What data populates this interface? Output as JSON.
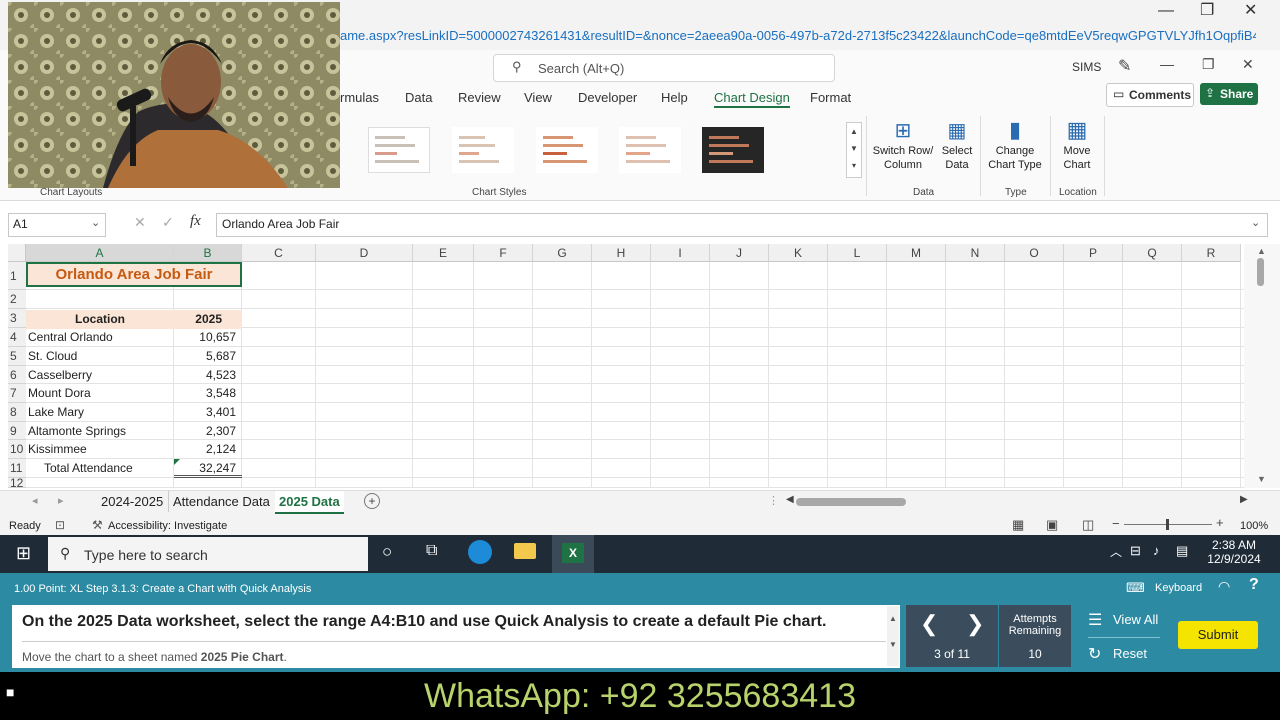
{
  "titlebar": {
    "url": "ame.aspx?resLinkID=5000002743261431&resultID=&nonce=2aeea90a-0056-497b-a72d-2713f5c23422&launchCode=qe8mtdEeV5reqwGPGTVLYJfh1OqpfiB4...",
    "minimize": "—",
    "restore": "❐",
    "close": "✕"
  },
  "ribbon": {
    "search_placeholder": "Search (Alt+Q)",
    "user": "SIMS",
    "tabs": [
      "rmulas",
      "Data",
      "Review",
      "View",
      "Developer",
      "Help",
      "Chart Design",
      "Format"
    ],
    "active_tab": "Chart Design",
    "comments_label": "Comments",
    "share_label": "Share",
    "chart_layouts_label": "Chart Layouts",
    "chart_styles_label": "Chart Styles",
    "switch_row_col": [
      "Switch Row/",
      "Column"
    ],
    "select_data": [
      "Select",
      "Data"
    ],
    "group_data": "Data",
    "change_chart_type": [
      "Change",
      "Chart Type"
    ],
    "group_type": "Type",
    "move_chart": [
      "Move",
      "Chart"
    ],
    "group_location": "Location"
  },
  "formula_bar": {
    "name_box": "A1",
    "fx": "fx",
    "formula": "Orlando Area Job Fair"
  },
  "grid": {
    "columns": [
      "A",
      "B",
      "C",
      "D",
      "E",
      "F",
      "G",
      "H",
      "I",
      "J",
      "K",
      "L",
      "M",
      "N",
      "O",
      "P",
      "Q",
      "R"
    ],
    "rows": [
      "1",
      "2",
      "3",
      "4",
      "5",
      "6",
      "7",
      "8",
      "9",
      "10",
      "11",
      "12"
    ],
    "title": "Orlando Area Job Fair",
    "header_location": "Location",
    "header_year": "2025",
    "data": [
      {
        "location": "Central Orlando",
        "value": "10,657"
      },
      {
        "location": "St. Cloud",
        "value": "5,687"
      },
      {
        "location": "Casselberry",
        "value": "4,523"
      },
      {
        "location": "Mount Dora",
        "value": "3,548"
      },
      {
        "location": "Lake Mary",
        "value": "3,401"
      },
      {
        "location": "Altamonte Springs",
        "value": "2,307"
      },
      {
        "location": "Kissimmee",
        "value": "2,124"
      }
    ],
    "total_label": "Total Attendance",
    "total_value": "32,247"
  },
  "sheet_tabs": [
    "2024-2025",
    "Attendance Data",
    "2025 Data"
  ],
  "active_sheet": "2025 Data",
  "status": {
    "ready": "Ready",
    "accessibility": "Accessibility: Investigate",
    "zoom": "100%"
  },
  "taskbar": {
    "search_placeholder": "Type here to search",
    "time": "2:38 AM",
    "date": "12/9/2024"
  },
  "sim": {
    "step_label": "1.00 Point: XL Step 3.1.3: Create a Chart with Quick Analysis",
    "keyboard": "Keyboard",
    "instruction": "On the 2025 Data worksheet, select the range A4:B10 and use Quick Analysis to create a default Pie chart.",
    "sub_instruction_prefix": "Move the chart to a sheet named ",
    "sub_instruction_bold": "2025 Pie Chart",
    "sub_instruction_suffix": ".",
    "progress": "3 of 11",
    "attempts_label": [
      "Attempts",
      "Remaining"
    ],
    "attempts_value": "10",
    "view_all": "View All",
    "reset": "Reset",
    "submit": "Submit"
  },
  "footer": {
    "whatsapp": "WhatsApp: +92 3255683413"
  },
  "colors": {
    "excel_green": "#1f7244",
    "header_fill": "#fbe5d6",
    "title_text": "#c55a11",
    "sim_teal": "#2c8ba3",
    "submit_yellow": "#f5e400"
  }
}
